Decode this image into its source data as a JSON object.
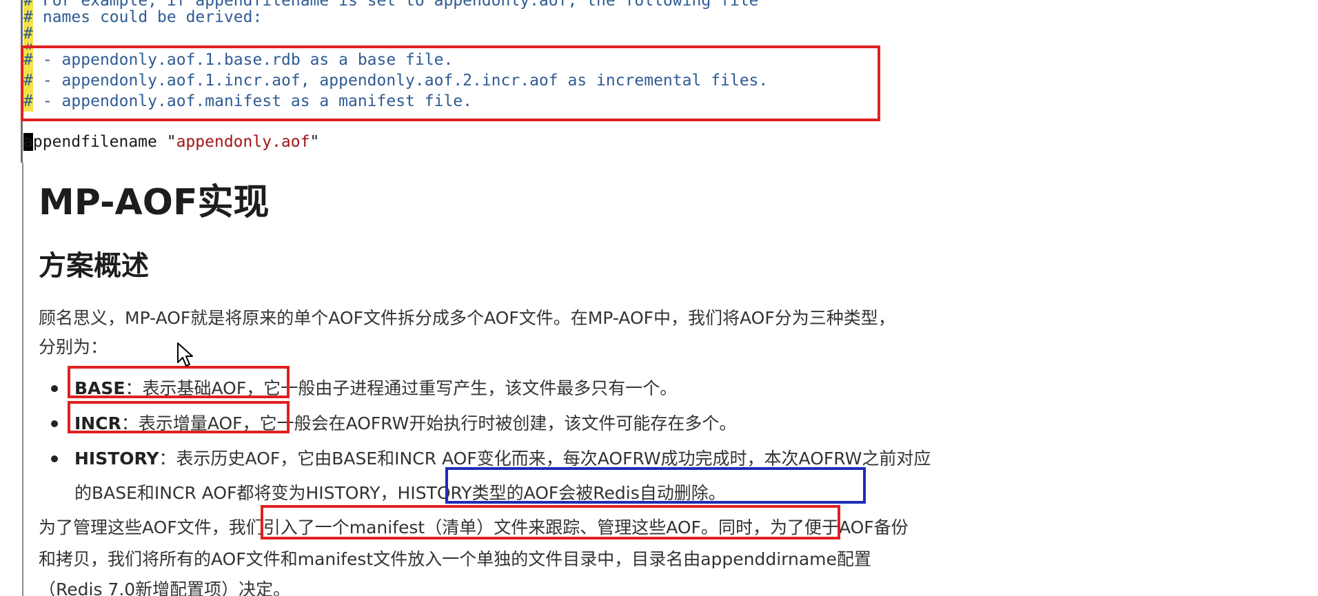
{
  "code": {
    "lines": [
      "For example, if appendfilename is set to appendonly.aof, the following file",
      "names could be derived:",
      "",
      "",
      "- appendonly.aof.1.base.rdb as a base file.",
      "- appendonly.aof.1.incr.aof, appendonly.aof.2.incr.aof as incremental files.",
      "- appendonly.aof.manifest as a manifest file."
    ],
    "hash": "#",
    "directive": {
      "keyword_first_char": "a",
      "keyword_rest": "ppendfilename",
      "open_quote": " \"",
      "value": "appendonly.aof",
      "close_quote": "\""
    }
  },
  "doc": {
    "title": "MP-AOF实现",
    "section": "方案概述",
    "intro_line1": "顾名思义，MP-AOF就是将原来的单个AOF文件拆分成多个AOF文件。在MP-AOF中，我们将AOF分为三种类型，",
    "intro_line2": "分别为：",
    "bullets": [
      {
        "term": "BASE",
        "highlight": "：表示基础AOF，",
        "rest": "它一般由子进程通过重写产生，该文件最多只有一个。"
      },
      {
        "term": "INCR",
        "highlight": "：表示增量AOF，",
        "rest": "它一般会在AOFRW开始执行时被创建，该文件可能存在多个。"
      },
      {
        "term": "HISTORY",
        "line1": "：表示历史AOF，它由BASE和INCR AOF变化而来，每次AOFRW成功完成时，本次AOFRW之前对应",
        "line2_pre": "的BASE和INCR AOF都将变为HISTORY，",
        "line2_highlight": "HISTORY类型的AOF会被Redis自动删除。"
      }
    ],
    "manage_pre": "为了管理这些AOF文件，",
    "manage_highlight": "我们引入了一个manifest（清单）文件来跟踪、管理这些AOF。",
    "manage_post": "同时，为了便于AOF备份",
    "manage_line2": "和拷贝，我们将所有的AOF文件和manifest文件放入一个单独的文件目录中，目录名由appenddirname配置",
    "manage_line3": "（Redis 7.0新增配置项）决定。"
  },
  "colors": {
    "annotation_red": "#e02020",
    "annotation_blue": "#1f2bb8",
    "comment_blue": "#2f5b93",
    "string_red": "#a31515",
    "hash_highlight": "#f5e24a"
  },
  "icons": {
    "mouse": "arrow-cursor-icon"
  }
}
